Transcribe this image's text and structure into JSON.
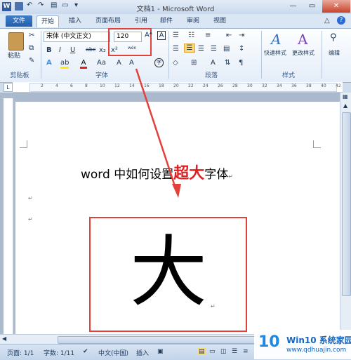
{
  "window": {
    "title": "文档1 - Microsoft Word"
  },
  "tabs": {
    "file": "文件",
    "home": "开始",
    "insert": "插入",
    "layout": "页面布局",
    "references": "引用",
    "mailings": "邮件",
    "review": "审阅",
    "view": "视图"
  },
  "ribbon": {
    "clipboard": {
      "paste": "粘贴",
      "label": "剪贴板"
    },
    "font": {
      "name": "宋体 (中文正文)",
      "size": "120",
      "label": "字体",
      "bold": "B",
      "italic": "I",
      "underline": "U",
      "strike": "abc",
      "sub": "x₂",
      "sup": "x²",
      "grow": "A",
      "shrink": "A",
      "case": "Aa",
      "clear": "A",
      "phonetic": "wén",
      "border_char": "A"
    },
    "paragraph": {
      "label": "段落"
    },
    "styles": {
      "quick": "快速样式",
      "change": "更改样式",
      "label": "样式"
    },
    "editing": {
      "edit": "编辑"
    }
  },
  "ruler": {
    "numbers": [
      "2",
      "4",
      "6",
      "8",
      "10",
      "12",
      "14",
      "16",
      "18",
      "20",
      "22",
      "24",
      "26",
      "28",
      "30",
      "32",
      "34",
      "36",
      "38",
      "40",
      "42"
    ]
  },
  "document": {
    "heading_pre": "word 中如何设置",
    "heading_red": "超大",
    "heading_post": "字体",
    "big_char": "大"
  },
  "status": {
    "page": "页面: 1/1",
    "words": "字数: 1/11",
    "lang": "中文(中国)",
    "mode": "插入"
  },
  "watermark": {
    "logo": "10",
    "title": "Win10 系统家园",
    "url": "www.qdhuajin.com"
  },
  "colors": {
    "highlight": "#e2403a",
    "accent": "#2a5ea9"
  }
}
